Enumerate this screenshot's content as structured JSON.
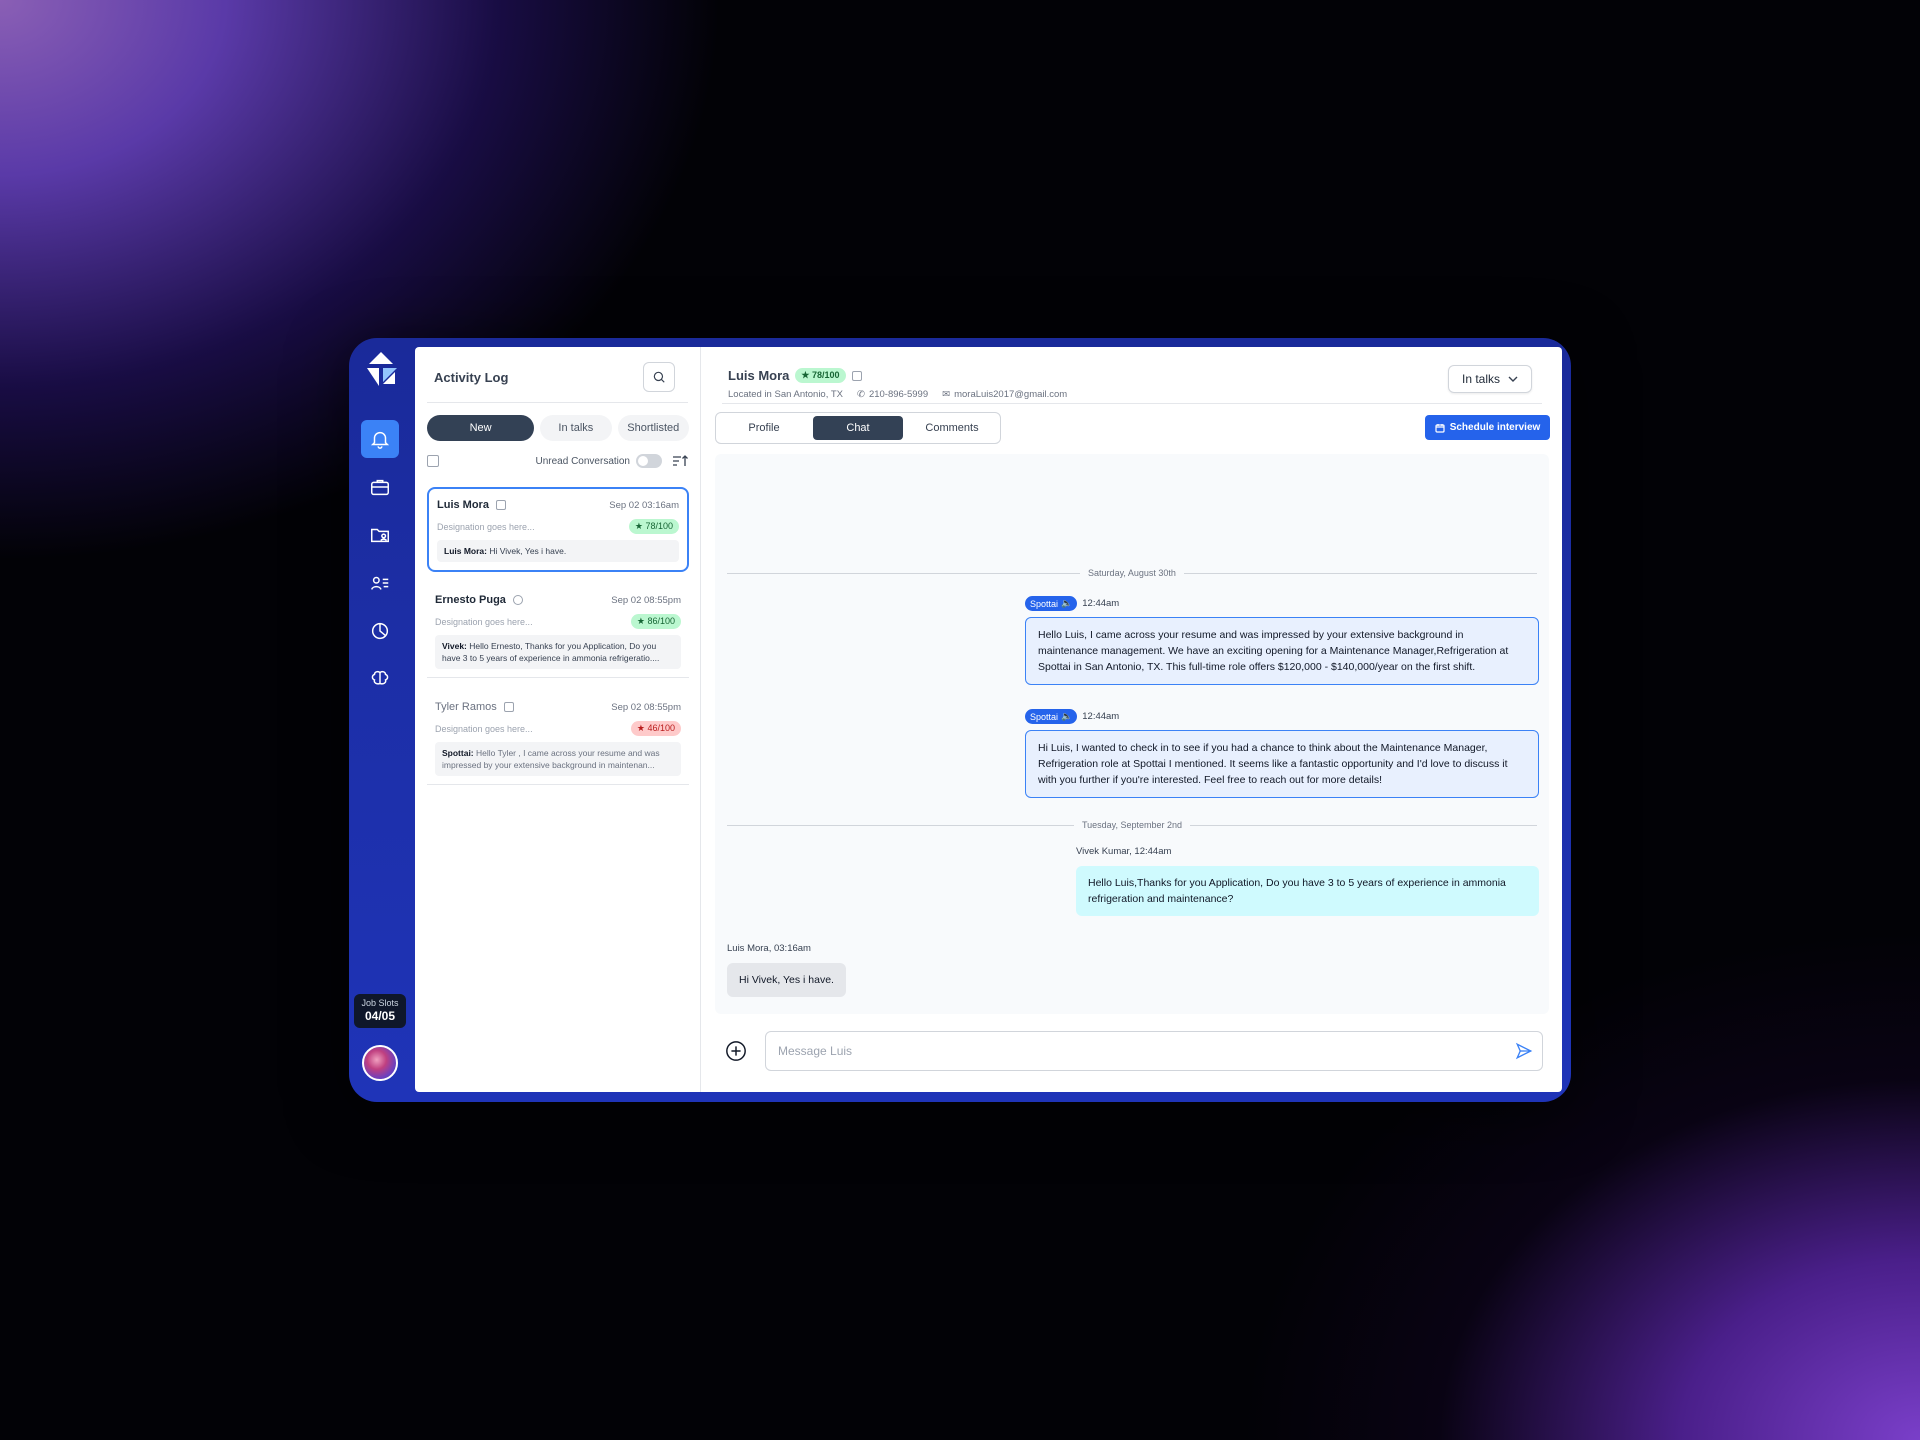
{
  "sidebar": {
    "items": [
      {
        "icon": "bell-icon",
        "active": true
      },
      {
        "icon": "briefcase-icon"
      },
      {
        "icon": "folder-user-icon"
      },
      {
        "icon": "user-list-icon"
      },
      {
        "icon": "pie-chart-icon"
      },
      {
        "icon": "brain-icon"
      }
    ],
    "job_slots_label": "Job Slots",
    "job_slots_value": "04/05"
  },
  "activity": {
    "title": "Activity Log",
    "filters": [
      "New",
      "In talks",
      "Shortlisted"
    ],
    "active_filter": "New",
    "unread_label": "Unread Conversation",
    "conversations": [
      {
        "name": "Luis Mora",
        "date": "Sep 02 03:16am",
        "designation": "Designation goes here...",
        "score": "78/100",
        "preview_sender": "Luis Mora:",
        "preview_text": " Hi Vivek, Yes i have."
      },
      {
        "name": "Ernesto Puga",
        "date": "Sep 02 08:55pm",
        "designation": "Designation goes here...",
        "score": "86/100",
        "preview_sender": "Vivek:",
        "preview_text": " Hello Ernesto, Thanks for you Application, Do you have 3 to 5 years of experience in ammonia refrigeratio...."
      },
      {
        "name": "Tyler Ramos",
        "date": "Sep 02 08:55pm",
        "designation": "Designation goes here...",
        "score": "46/100",
        "preview_sender": "Spottai:",
        "preview_text": " Hello Tyler , I came across your resume and was impressed by your extensive background in maintenan..."
      }
    ]
  },
  "candidate": {
    "name": "Luis Mora",
    "score": "78/100",
    "location": "Located in San Antonio, TX",
    "phone": "210-896-5999",
    "email": "moraLuis2017@gmail.com",
    "status": "In talks"
  },
  "tabs": [
    "Profile",
    "Chat",
    "Comments"
  ],
  "active_tab": "Chat",
  "schedule_label": "Schedule interview",
  "chat": {
    "date1": "Saturday, August 30th",
    "msg1_sender": "Spottai",
    "msg1_time": "12:44am",
    "msg1_text": "Hello Luis, I came across your resume and was impressed by your extensive background in maintenance management. We have an exciting opening for a Maintenance Manager,Refrigeration at Spottai in San Antonio, TX. This full-time role offers $120,000 - $140,000/year on the first shift.",
    "msg2_sender": "Spottai",
    "msg2_time": "12:44am",
    "msg2_text": "Hi Luis, I wanted to check in to see if you had a chance to think about the Maintenance Manager, Refrigeration role at Spottai I mentioned. It seems like a fantastic opportunity and I'd love to discuss it with you further if you're interested. Feel free to reach out for more details!",
    "date2": "Tuesday, September 2nd",
    "msg3_head": "Vivek Kumar, 12:44am",
    "msg3_text": "Hello Luis,Thanks for you Application, Do you have 3 to 5 years of experience in ammonia refrigeration and maintenance?",
    "msg4_head": "Luis Mora, 03:16am",
    "msg4_text": "Hi Vivek, Yes i have."
  },
  "composer": {
    "placeholder": "Message Luis"
  },
  "colors": {
    "accent": "#2563eb",
    "frame": "#1f34b8",
    "dark_pill": "#334155"
  }
}
